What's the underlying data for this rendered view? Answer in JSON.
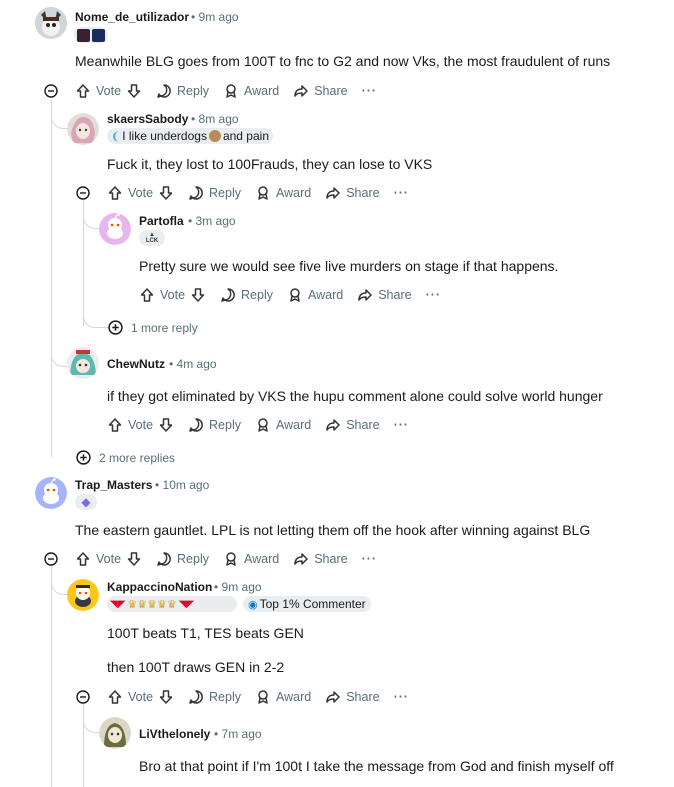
{
  "actions": {
    "vote": "Vote",
    "reply": "Reply",
    "award": "Award",
    "share": "Share",
    "more": "···"
  },
  "colors": {
    "thread_line": "#d4d8db",
    "meta": "#576f76",
    "flair_bg": "#e9edf0"
  },
  "comments": [
    {
      "username": "Nome_de_utilizador",
      "time": "9m ago",
      "text": "Meanwhile BLG goes from 100T to fnc to G2 and now Vks, the most fraudulent of runs",
      "flair_icons": [
        "team-logo-icon",
        "team-logo-icon"
      ]
    },
    {
      "username": "skaersSabody",
      "time": "8m ago",
      "flair_text": "I like underdogs",
      "flair_text2": "and pain",
      "text": "Fuck it, they lost to 100Frauds, they can lose to VKS"
    },
    {
      "username": "Partofla",
      "time": "3m ago",
      "flair_icons": [
        "lck-icon"
      ],
      "flair_label": "LCK",
      "text": "Pretty sure we would see five live murders on stage if that happens."
    },
    {
      "username": "ChewNutz",
      "time": "4m ago",
      "text": "if they got eliminated by VKS the hupu comment alone could solve world hunger"
    },
    {
      "username": "Trap_Masters",
      "time": "10m ago",
      "flair_icons": [
        "crystal-icon"
      ],
      "text": "The eastern gauntlet. LPL is not letting them off the hook after winning against BLG"
    },
    {
      "username": "KappaccinoNation",
      "time": "9m ago",
      "badge": "Top 1% Commenter",
      "text": "100T beats T1, TES beats GEN",
      "text2": "then 100T draws GEN in 2-2"
    },
    {
      "username": "LiVthelonely",
      "time": "7m ago",
      "text": "Bro at that point if I'm 100t I take the message from God and finish myself off"
    }
  ],
  "more_replies": [
    {
      "label": "1 more reply"
    },
    {
      "label": "2 more replies"
    }
  ]
}
